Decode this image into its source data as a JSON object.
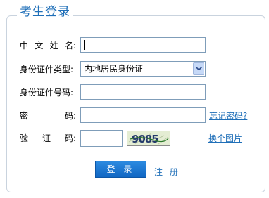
{
  "form": {
    "title": "考生登录",
    "fields": {
      "name": {
        "label_chars": [
          "中",
          "文",
          "姓",
          "名:"
        ],
        "value": ""
      },
      "id_type": {
        "label": "身份证件类型:",
        "selected": "内地居民身份证"
      },
      "id_number": {
        "label": "身份证件号码:",
        "value": ""
      },
      "password": {
        "label_chars": [
          "密",
          "码:"
        ],
        "value": "",
        "forgot_link": "忘记密码?"
      },
      "captcha": {
        "label_chars": [
          "验",
          "证",
          "码:"
        ],
        "value": "",
        "image_text": "9085",
        "refresh_link": "换个图片"
      }
    },
    "login_button": "登 录",
    "register_link": "注 册"
  },
  "colors": {
    "accent": "#1f6fb8",
    "button": "#1a76d2",
    "border": "#7f9db9"
  }
}
